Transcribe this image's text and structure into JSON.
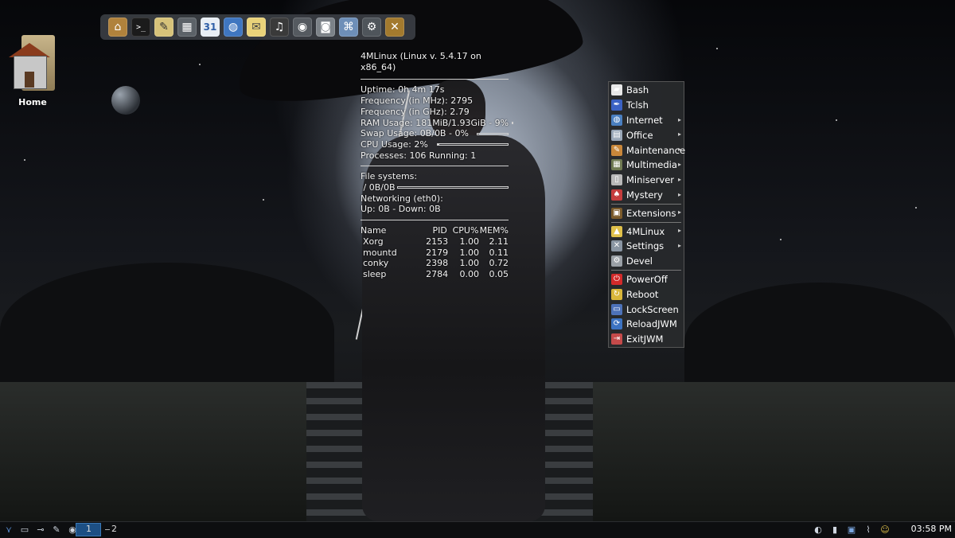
{
  "desktop": {
    "home_label": "Home"
  },
  "launcher": {
    "icons": [
      "home-folder-icon",
      "terminal-icon",
      "text-editor-icon",
      "calculator-icon",
      "calendar-icon",
      "browser-icon",
      "mail-icon",
      "headphones-icon",
      "film-reel-icon",
      "camera-icon",
      "network-icon",
      "settings-icon",
      "tools-icon"
    ],
    "calendar_text": "31",
    "terminal_text": ">_"
  },
  "conky": {
    "title": "4MLinux (Linux v. 5.4.17 on x86_64)",
    "uptime_label": "Uptime:",
    "uptime_value": "0h 4m 17s",
    "freq_mhz_label": "Frequency (in MHz):",
    "freq_mhz_value": "2795",
    "freq_ghz_label": "Frequency (in GHz):",
    "freq_ghz_value": "2.79",
    "ram_label": "RAM Usage:",
    "ram_value": "181MiB/1.93GiB - 9%",
    "ram_percent": 9,
    "swap_label": "Swap Usage:",
    "swap_value": "0B/0B - 0%",
    "swap_percent": 0,
    "cpu_label": "CPU Usage:",
    "cpu_value": "2%",
    "cpu_percent": 2,
    "processes_label": "Processes:",
    "processes_value": "106",
    "running_label": "Running:",
    "running_value": "1",
    "fs_label": "File systems:",
    "fs_root_label": "/",
    "fs_root_value": "0B/0B",
    "fs_percent": 0,
    "net_label": "Networking (eth0):",
    "net_up_label": "Up:",
    "net_up_value": "0B",
    "net_down_label": "- Down:",
    "net_down_value": "0B",
    "proc_headers": {
      "name": "Name",
      "pid": "PID",
      "cpu": "CPU%",
      "mem": "MEM%"
    },
    "processes": [
      {
        "name": "Xorg",
        "pid": "2153",
        "cpu": "1.00",
        "mem": "2.11"
      },
      {
        "name": "mountd",
        "pid": "2179",
        "cpu": "1.00",
        "mem": "0.11"
      },
      {
        "name": "conky",
        "pid": "2398",
        "cpu": "1.00",
        "mem": "0.72"
      },
      {
        "name": "sleep",
        "pid": "2784",
        "cpu": "0.00",
        "mem": "0.05"
      }
    ]
  },
  "menu": {
    "items": [
      {
        "label": "Bash",
        "icon": "bash-icon",
        "color": "#e8e8e8",
        "submenu": false
      },
      {
        "label": "Tclsh",
        "icon": "feather-icon",
        "color": "#3b62c4",
        "submenu": false
      },
      {
        "label": "Internet",
        "icon": "globe-icon",
        "color": "#4a7fc0",
        "submenu": true
      },
      {
        "label": "Office",
        "icon": "document-icon",
        "color": "#9aa8b8",
        "submenu": true
      },
      {
        "label": "Maintenance",
        "icon": "brush-icon",
        "color": "#c8873a",
        "submenu": true
      },
      {
        "label": "Multimedia",
        "icon": "film-icon",
        "color": "#6f7a52",
        "submenu": true
      },
      {
        "label": "Miniserver",
        "icon": "server-icon",
        "color": "#b8b8b8",
        "submenu": true
      },
      {
        "label": "Mystery",
        "icon": "cards-icon",
        "color": "#c53d3d",
        "submenu": true
      },
      {
        "label": "Extensions",
        "icon": "box-icon",
        "color": "#7b5a2a",
        "submenu": true
      },
      {
        "label": "4MLinux",
        "icon": "tux-icon",
        "color": "#e0c14a",
        "submenu": true
      },
      {
        "label": "Settings",
        "icon": "tools-icon",
        "color": "#8a96a3",
        "submenu": true
      },
      {
        "label": "Devel",
        "icon": "gear-icon",
        "color": "#9aa0a6",
        "submenu": false
      },
      {
        "label": "PowerOff",
        "icon": "power-icon",
        "color": "#d32a2a",
        "submenu": false
      },
      {
        "label": "Reboot",
        "icon": "reboot-icon",
        "color": "#d8b63a",
        "submenu": false
      },
      {
        "label": "LockScreen",
        "icon": "lock-screen-icon",
        "color": "#4d72b8",
        "submenu": false
      },
      {
        "label": "ReloadJWM",
        "icon": "reload-icon",
        "color": "#3c73c2",
        "submenu": false
      },
      {
        "label": "ExitJWM",
        "icon": "exit-icon",
        "color": "#c54a4a",
        "submenu": false
      }
    ],
    "arrow": "▸"
  },
  "tray": {
    "left_icons": [
      "menu-icon",
      "drive-icon",
      "usb-icon",
      "chat-icon",
      "eye-icon"
    ],
    "pager": [
      "1",
      "2"
    ],
    "right_icons": [
      "volume-icon",
      "battery-icon",
      "network-icon",
      "paperclip-icon",
      "user-icon"
    ],
    "clock": "03:58 PM"
  }
}
